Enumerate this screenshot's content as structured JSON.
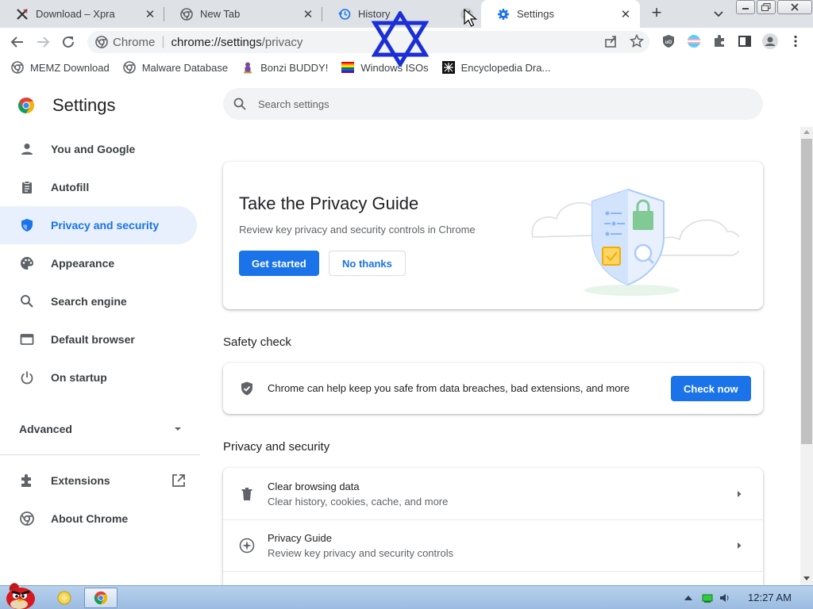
{
  "tabs": [
    {
      "title": "Download – Xpra",
      "favicon": "xpra-icon"
    },
    {
      "title": "New Tab",
      "favicon": "chrome-icon"
    },
    {
      "title": "History",
      "favicon": "history-icon"
    },
    {
      "title": "Settings",
      "favicon": "gear-icon",
      "active": true
    }
  ],
  "toolbar": {
    "site_label": "Chrome",
    "url_host": "chrome://settings",
    "url_path": "/privacy"
  },
  "bookmarks": [
    {
      "label": "MEMZ Download",
      "icon": "globe-icon"
    },
    {
      "label": "Malware Database",
      "icon": "globe-icon"
    },
    {
      "label": "Bonzi BUDDY!",
      "icon": "bonzi-icon"
    },
    {
      "label": "Windows ISOs",
      "icon": "rainbow-flag-icon"
    },
    {
      "label": "Encyclopedia Dra...",
      "icon": "ed-icon"
    }
  ],
  "settings": {
    "title": "Settings",
    "search_placeholder": "Search settings",
    "nav": [
      {
        "label": "You and Google",
        "icon": "person-icon"
      },
      {
        "label": "Autofill",
        "icon": "clipboard-icon"
      },
      {
        "label": "Privacy and security",
        "icon": "shield-icon",
        "active": true
      },
      {
        "label": "Appearance",
        "icon": "palette-icon"
      },
      {
        "label": "Search engine",
        "icon": "search-icon"
      },
      {
        "label": "Default browser",
        "icon": "browser-icon"
      },
      {
        "label": "On startup",
        "icon": "power-icon"
      }
    ],
    "advanced_label": "Advanced",
    "extensions_label": "Extensions",
    "about_label": "About Chrome"
  },
  "privacy_guide": {
    "title": "Take the Privacy Guide",
    "subtitle": "Review key privacy and security controls in Chrome",
    "primary_label": "Get started",
    "secondary_label": "No thanks"
  },
  "safety_check": {
    "section_title": "Safety check",
    "text": "Chrome can help keep you safe from data breaches, bad extensions, and more",
    "button_label": "Check now"
  },
  "privacy_section": {
    "section_title": "Privacy and security",
    "rows": [
      {
        "title": "Clear browsing data",
        "subtitle": "Clear history, cookies, cache, and more",
        "icon": "trash-icon"
      },
      {
        "title": "Privacy Guide",
        "subtitle": "Review key privacy and security controls",
        "icon": "compass-icon"
      }
    ]
  },
  "taskbar": {
    "clock": "12:27 AM"
  },
  "colors": {
    "accent": "#1a73e8",
    "nav_active_bg": "#e8f0fe",
    "tabstrip_bg": "#dee1e6",
    "overlay_star": "#1a2fd6"
  }
}
